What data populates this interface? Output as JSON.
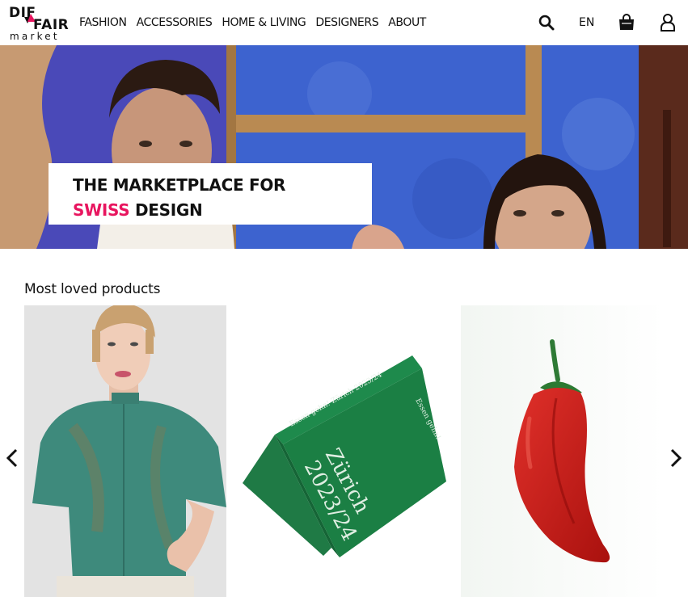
{
  "header": {
    "logo": {
      "line1": "DIF",
      "line2": "FAIR",
      "line3": "market"
    },
    "nav": [
      "FASHION",
      "ACCESSORIES",
      "HOME & LIVING",
      "DESIGNERS",
      "ABOUT"
    ],
    "language": "EN",
    "icons": [
      "search-icon",
      "shopping-bag-icon",
      "user-icon"
    ]
  },
  "hero": {
    "title_line1": "THE MARKETPLACE FOR",
    "title_accent": "SWISS",
    "title_line2_rest": " DESIGN",
    "accent_color": "#e8155f"
  },
  "products_section": {
    "title": "Most loved products",
    "items": [
      {
        "name": "green-silk-blouse",
        "image": "woman-in-green-blouse"
      },
      {
        "name": "zurich-guide-book",
        "image": "green-book",
        "cover_lines": [
          "Zürich",
          "2023/24"
        ],
        "spine_text": "Essen gehn!   Zürich   2023/24",
        "back_text": "Essen gehn!"
      },
      {
        "name": "red-chili-object",
        "image": "red-chili-pepper"
      }
    ],
    "prev_icon": "chevron-left-icon",
    "next_icon": "chevron-right-icon"
  }
}
